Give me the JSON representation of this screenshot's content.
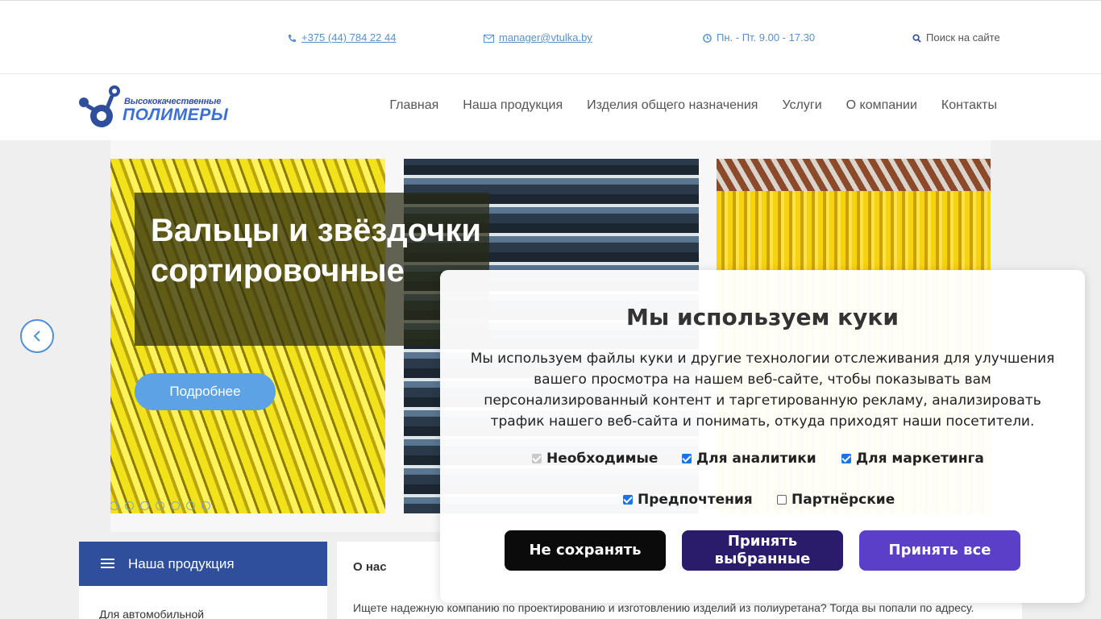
{
  "topbar": {
    "phone": "+375 (44) 784 22 44",
    "email": "manager@vtulka.by",
    "hours": "Пн. - Пт. 9.00 - 17.30",
    "search": "Поиск на сайте"
  },
  "logo": {
    "line1": "Высококачественные",
    "line2": "ПОЛИМЕРЫ"
  },
  "nav": [
    "Главная",
    "Наша продукция",
    "Изделия общего назначения",
    "Услуги",
    "О компании",
    "Контакты"
  ],
  "slider": {
    "title": "Вальцы и звёздочки сортировочные",
    "button": "Подробнее",
    "dots_count": 8,
    "active_dot": 0
  },
  "products": {
    "title": "Наша продукция",
    "first_item": "Для автомобильной"
  },
  "about": {
    "title": "О нас",
    "text": "Ищете надежную компанию по проектированию и изготовлению изделий из полиуретана? Тогда вы попали по адресу."
  },
  "cookie": {
    "title": "Мы используем куки",
    "description": "Мы используем файлы куки и другие технологии отслеживания для улучшения вашего просмотра на нашем веб-сайте, чтобы показывать вам персонализированный контент и таргетированную рекламу, анализировать трафик нашего веб-сайта и понимать, откуда приходят наши посетители.",
    "options": {
      "necessary": "Необходимые",
      "analytics": "Для аналитики",
      "marketing": "Для маркетинга",
      "preferences": "Предпочтения",
      "partners": "Партнёрские"
    },
    "buttons": {
      "decline": "Не сохранять",
      "accept_selected": "Принять выбранные",
      "accept_all": "Принять все"
    }
  },
  "colors": {
    "brand_blue": "#2f4f9c",
    "link_blue": "#5b8fc9",
    "accept_all": "#5b3fc8",
    "accept_selected": "#2a1b6b"
  }
}
